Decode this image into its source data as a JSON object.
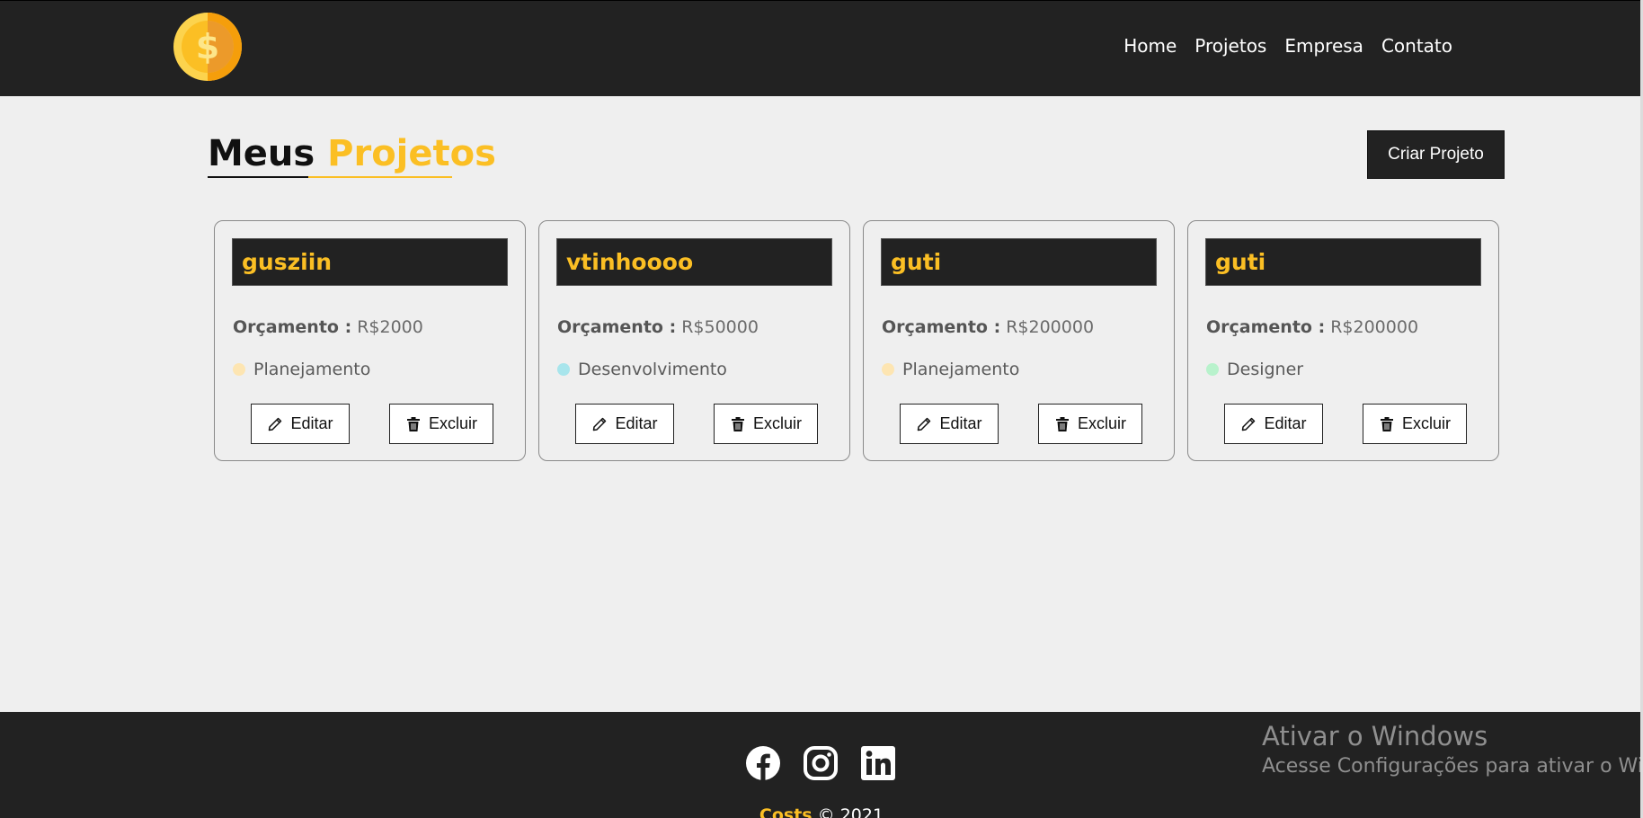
{
  "nav": {
    "logo_icon": "dollar-coin-icon",
    "links": [
      "Home",
      "Projetos",
      "Empresa",
      "Contato"
    ]
  },
  "page": {
    "title_part1": "Meus",
    "title_part2": "Projetos",
    "create_button": "Criar Projeto"
  },
  "projects": [
    {
      "name": "gusziin",
      "budget_label": "Orçamento :",
      "budget_value": "R$2000",
      "category": "Planejamento",
      "category_color": "#fde5b2",
      "edit_label": "Editar",
      "delete_label": "Excluir"
    },
    {
      "name": "vtinhoooo",
      "budget_label": "Orçamento :",
      "budget_value": "R$50000",
      "category": "Desenvolvimento",
      "category_color": "#a8e5ec",
      "edit_label": "Editar",
      "delete_label": "Excluir"
    },
    {
      "name": "guti",
      "budget_label": "Orçamento :",
      "budget_value": "R$200000",
      "category": "Planejamento",
      "category_color": "#fde5b2",
      "edit_label": "Editar",
      "delete_label": "Excluir"
    },
    {
      "name": "guti",
      "budget_label": "Orçamento :",
      "budget_value": "R$200000",
      "category": "Designer",
      "category_color": "#b8f2cc",
      "edit_label": "Editar",
      "delete_label": "Excluir"
    }
  ],
  "footer": {
    "social_icons": [
      "facebook-icon",
      "instagram-icon",
      "linkedin-icon"
    ],
    "brand": "Costs",
    "copyright": "© 2021"
  },
  "watermark": {
    "line1": "Ativar o Windows",
    "line2": "Acesse Configurações para ativar o Windows."
  },
  "colors": {
    "accent": "#fbbf24",
    "dark": "#222222",
    "background": "#efefef"
  }
}
